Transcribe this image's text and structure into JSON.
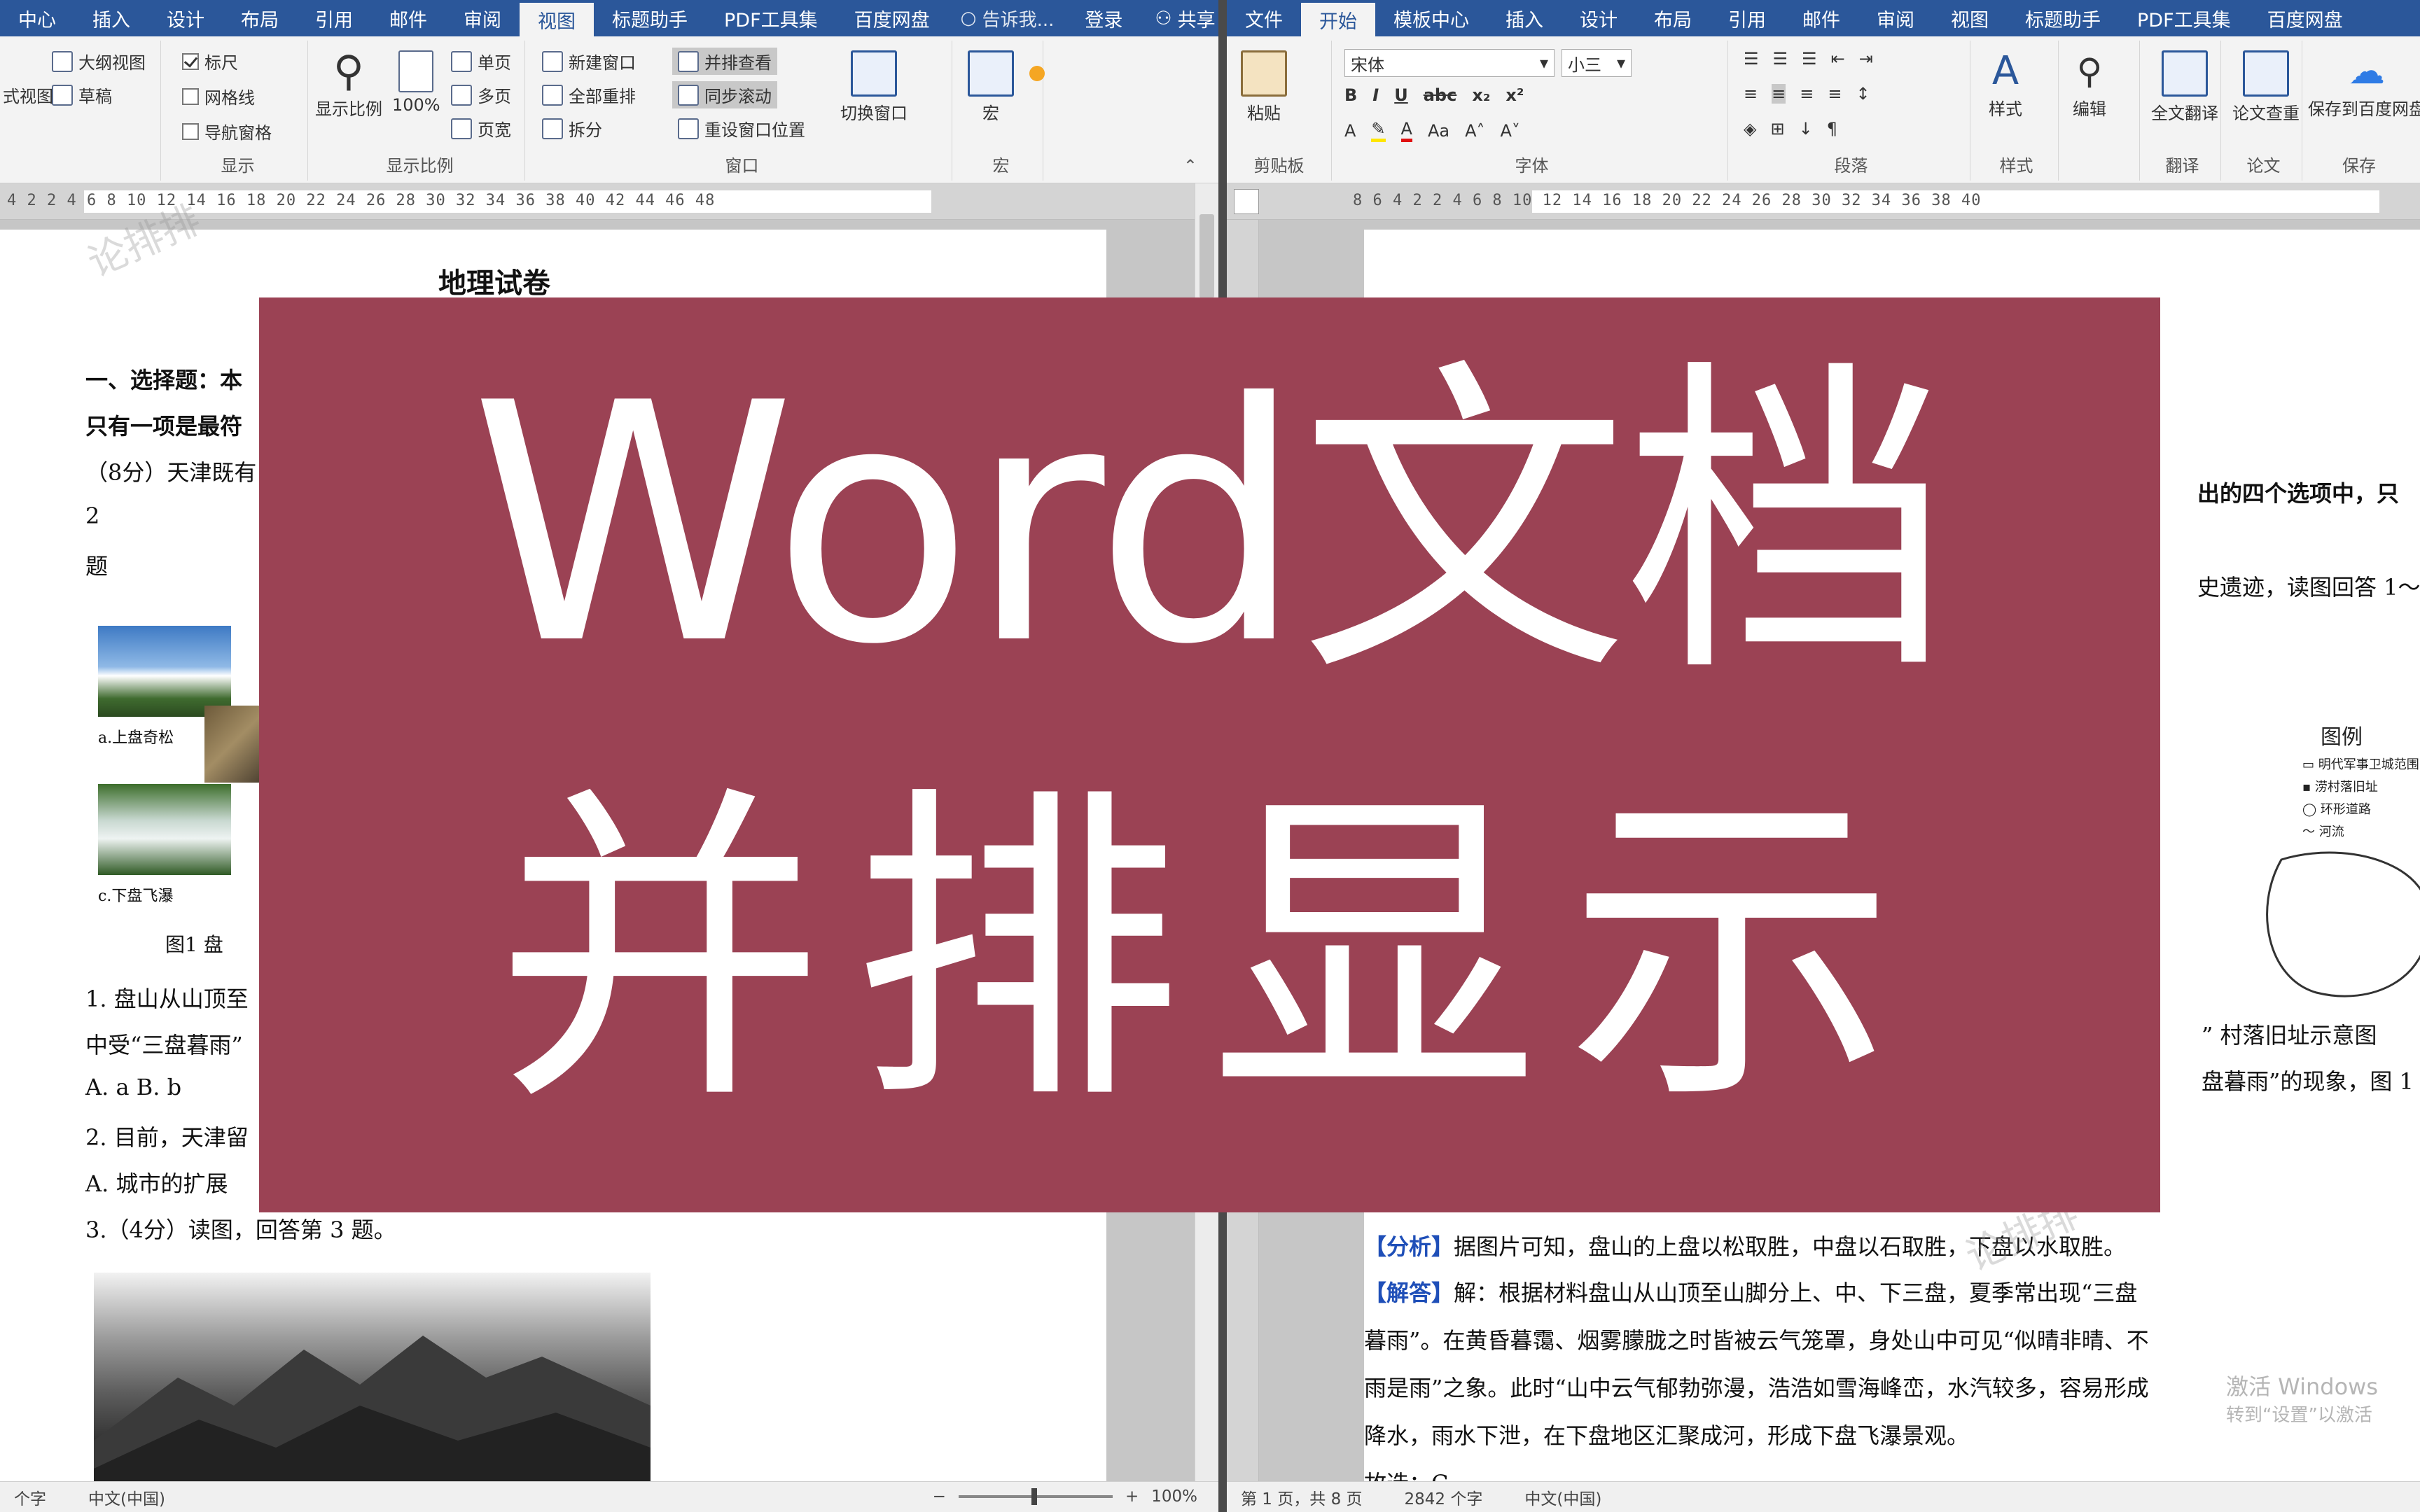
{
  "left_window": {
    "tabs": [
      "中心",
      "插入",
      "设计",
      "布局",
      "引用",
      "邮件",
      "审阅",
      "视图",
      "标题助手",
      "PDF工具集",
      "百度网盘"
    ],
    "active_tab": "视图",
    "tell_me": "告诉我...",
    "login": "登录",
    "share": "共享",
    "ribbon": {
      "views": {
        "read_label": "式视图",
        "outline": "大纲视图",
        "draft": "草稿",
        "group_label": ""
      },
      "show": {
        "ruler": "标尺",
        "gridlines": "网格线",
        "nav_pane": "导航窗格",
        "group_label": "显示"
      },
      "zoom": {
        "zoom": "显示比例",
        "100": "100%",
        "one_page": "单页",
        "multi_page": "多页",
        "page_width": "页宽",
        "group_label": "显示比例"
      },
      "window": {
        "new_window": "新建窗口",
        "arrange_all": "全部重排",
        "split": "拆分",
        "side_by_side": "并排查看",
        "sync_scroll": "同步滚动",
        "reset_pos": "重设窗口位置",
        "switch_windows": "切换窗口",
        "group_label": "窗口"
      },
      "macro": {
        "macro": "宏",
        "group_label": "宏"
      }
    },
    "ruler_numbers": "4   2        2   4   6   8   10  12  14  16  18  20  22  24  26  28  30  32  34  36  38  40  42  44  46  48",
    "document": {
      "title": "地理试卷",
      "section1": "一、选择题：本",
      "section1b": "只有一项是最符",
      "q_intro": "（8分）天津既有",
      "num2": "2",
      "ti": "题",
      "cap_a": "a.上盘奇松",
      "cap_c": "c.下盘飞瀑",
      "fig1": "图1   盘",
      "q1": "1.  盘山从山顶至",
      "q1b": "中受“三盘暮雨”",
      "q1c": "A.  a     B.  b",
      "q2": "2.  目前，天津留",
      "q2a": "A.  城市的扩展",
      "q3": "3.（4分）读图，回答第 3 题。"
    },
    "status": {
      "words": "个字",
      "lang": "中文(中国)",
      "zoom": "100%"
    }
  },
  "right_window": {
    "tabs": [
      "文件",
      "开始",
      "模板中心",
      "插入",
      "设计",
      "布局",
      "引用",
      "邮件",
      "审阅",
      "视图",
      "标题助手",
      "PDF工具集",
      "百度网盘"
    ],
    "active_tab": "开始",
    "ribbon": {
      "clipboard": {
        "paste": "粘贴",
        "group_label": "剪贴板"
      },
      "font": {
        "family": "宋体",
        "size": "小三",
        "group_label": "字体"
      },
      "paragraph": {
        "group_label": "段落"
      },
      "styles": {
        "styles": "样式",
        "group_label": "样式"
      },
      "editing": {
        "editing": "编辑"
      },
      "translate": {
        "full_translate": "全文翻译",
        "group_label": "翻译"
      },
      "paper": {
        "check": "论文查重",
        "group_label": "论文"
      },
      "save": {
        "save_baidu": "保存到百度网盘",
        "group_label": "保存"
      }
    },
    "ruler_numbers": "8   6   4   2        2   4   6   8   10  12  14  16  18  20  22  24  26  28  30  32  34  36  38  40",
    "document": {
      "frag1": "出的四个选项中，只",
      "frag2": "史遗迹，读图回答 1～",
      "legend_title": "图例",
      "legend_1": "明代军事卫城范围",
      "legend_2": "涝村落旧址",
      "legend_3": "环形道路",
      "legend_4": "河流",
      "frag3": "” 村落旧址示意图",
      "frag4": "盘暮雨”的现象，图 1",
      "analysis_tag": "【分析】",
      "analysis": "据图片可知，盘山的上盘以松取胜，中盘以石取胜，下盘以水取胜。",
      "solution_tag": "【解答】",
      "solution_1": "解：根据材料盘山从山顶至山脚分上、中、下三盘，夏季常出现“三盘",
      "solution_2": "暮雨”。在黄昏暮霭、烟雾朦胧之时皆被云气笼罩，身处山中可见“似晴非晴、不",
      "solution_3": "雨是雨”之象。此时“山中云气郁勃弥漫，浩浩如雪海峰峦，水汽较多，容易形成",
      "solution_4": "降水，雨水下泄，在下盘地区汇聚成河，形成下盘飞瀑景观。",
      "answer": "故选：C。"
    },
    "status": {
      "page": "第 1 页，共 8 页",
      "words": "2842 个字",
      "lang": "中文(中国)"
    },
    "activate_1": "激活 Windows",
    "activate_2": "转到“设置”以激活"
  },
  "overlay": {
    "line1": "Word文档",
    "line2": "并排显示"
  },
  "watermark": "论排排",
  "colors": {
    "ribbon_blue": "#2b579a",
    "overlay": "#9b4254",
    "tag_blue": "#1f4fb8"
  }
}
